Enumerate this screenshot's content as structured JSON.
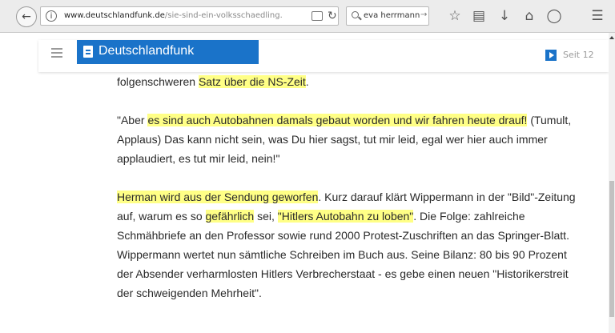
{
  "browser": {
    "url_host": "www.deutschlandfunk.de",
    "url_path": "/sie-sind-ein-volksschaedling.",
    "search_query": "eva herrmann"
  },
  "site": {
    "brand": "Deutschlandfunk",
    "page": "Seit 12"
  },
  "article": {
    "p0": {
      "a": "folgenschweren ",
      "b": "Satz über die NS-Zeit",
      "c": "."
    },
    "p1": {
      "a": "\"Aber ",
      "b": "es sind auch Autobahnen damals gebaut worden und wir fahren heute drauf!",
      "c": " (Tumult, Applaus) Das kann nicht sein, was Du hier sagst, tut mir leid, egal wer hier auch immer applaudiert, es tut mir leid, nein!\""
    },
    "p2": {
      "a": "Herman wird aus der Sendung geworfen",
      "b": ". Kurz darauf klärt Wippermann in der \"Bild\"-Zeitung auf, warum es so ",
      "c": "gefährlich",
      "d": " sei, ",
      "e": "\"Hitlers Autobahn zu loben\"",
      "f": ". Die Folge: zahlreiche Schmähbriefe an den Professor sowie rund 2000 Protest-Zuschriften an das Springer-Blatt. Wippermann wertet nun sämtliche Schreiben im Buch aus. Seine Bilanz: 80 bis 90 Prozent der Absender verharmlosten Hitlers Verbrecherstaat - es gebe einen neuen \"Historikerstreit der schweigenden Mehrheit\"."
    }
  },
  "colors": {
    "brand": "#1a73c9",
    "highlight": "#ffff86"
  },
  "icons": [
    "back-arrow-icon",
    "info-icon",
    "reader-view-icon",
    "reload-icon",
    "search-icon",
    "bookmark-star-icon",
    "reading-list-icon",
    "download-icon",
    "home-icon",
    "pocket-icon",
    "menu-icon",
    "hamburger-icon",
    "document-icon",
    "play-icon"
  ]
}
